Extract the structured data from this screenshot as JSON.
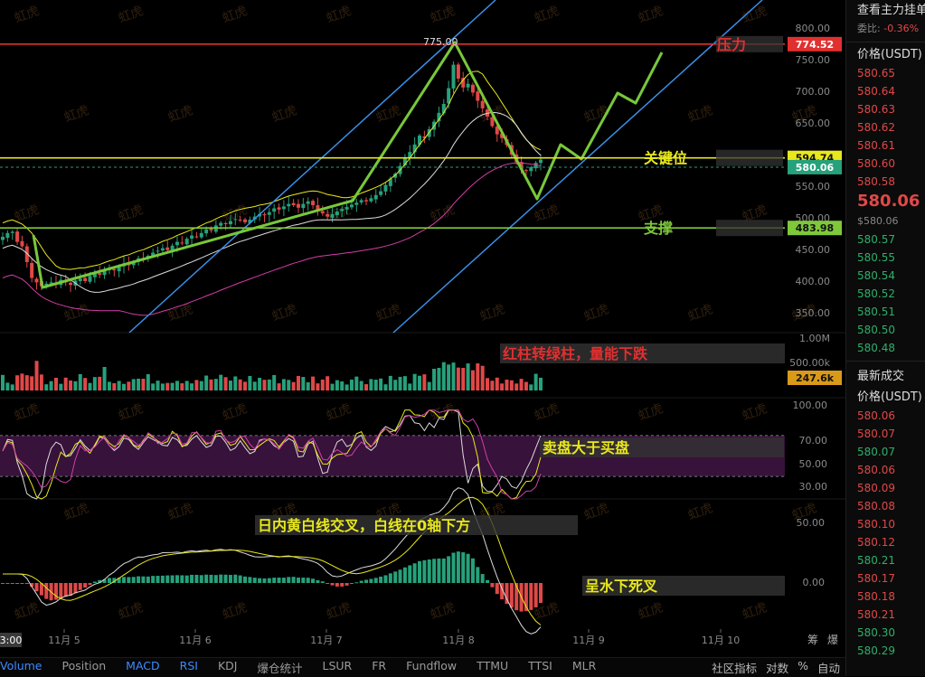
{
  "chart_data": [
    {
      "type": "candlestick",
      "panel": "price",
      "x_labels": [
        "11月 5",
        "11月 6",
        "11月 7",
        "11月 8",
        "11月 9",
        "11月 10"
      ],
      "x_extra_labels": [
        "3:00",
        "筹",
        "爆"
      ],
      "y_ticks": [
        "800.00",
        "750.00",
        "700.00",
        "650.00",
        "600.00",
        "550.00",
        "500.00",
        "450.00",
        "400.00",
        "350.00"
      ],
      "ylim": [
        320,
        820
      ],
      "approx_closes": [
        470,
        476,
        478,
        462,
        455,
        430,
        405,
        398,
        392,
        396,
        398,
        395,
        402,
        398,
        394,
        401,
        404,
        400,
        408,
        412,
        410,
        416,
        420,
        417,
        422,
        428,
        425,
        431,
        436,
        434,
        440,
        445,
        448,
        452,
        449,
        456,
        462,
        460,
        467,
        472,
        470,
        476,
        482,
        480,
        488,
        492,
        490,
        495,
        498,
        496,
        493,
        497,
        502,
        506,
        504,
        509,
        515,
        513,
        518,
        522,
        520,
        516,
        522,
        526,
        520,
        512,
        507,
        502,
        506,
        510,
        514,
        517,
        521,
        524,
        528,
        526,
        531,
        536,
        542,
        552,
        562,
        570,
        582,
        594,
        604,
        616,
        630,
        626,
        640,
        652,
        666,
        680,
        705,
        742,
        720,
        706,
        712,
        698,
        685,
        673,
        660,
        645,
        632,
        626,
        615,
        600,
        588,
        577,
        574,
        580,
        587,
        592
      ],
      "lines": [
        {
          "label": "774.52",
          "value": 774.52,
          "color": "#e03030"
        },
        {
          "label": "594.74",
          "value": 594.74,
          "color": "#e8e81c"
        },
        {
          "label": "580.06",
          "value": 580.06,
          "color": "#26a17b",
          "dashed": true
        },
        {
          "label": "483.98",
          "value": 483.98,
          "color": "#7ec83a"
        }
      ],
      "peak_label": "775.00",
      "annotations": [
        {
          "text": "压力",
          "color": "#e03030"
        },
        {
          "text": "关键位",
          "color": "#e8e81c"
        },
        {
          "text": "支撑",
          "color": "#7ec83a"
        }
      ]
    },
    {
      "type": "bar",
      "panel": "volume",
      "y_ticks": [
        "1.00M",
        "500.00k"
      ],
      "current_label": "247.6k",
      "annotation": "红柱转绿柱，量能下跌"
    },
    {
      "type": "line",
      "panel": "RSI",
      "y_ticks": [
        "100.00",
        "70.00",
        "50.00",
        "30.00"
      ],
      "ylim": [
        0,
        100
      ],
      "band": [
        30,
        70
      ],
      "annotation": "卖盘大于买盘"
    },
    {
      "type": "bar",
      "panel": "MACD",
      "y_ticks": [
        "50.00",
        "0.00"
      ],
      "annotations": [
        "日内黄白线交叉，白线在0轴下方",
        "呈水下死叉"
      ]
    }
  ],
  "watermark": "虹虎",
  "tabs": [
    "Volume",
    "Position",
    "MACD",
    "RSI",
    "KDJ",
    "爆仓统计",
    "LSUR",
    "FR",
    "Fundflow",
    "TTMU",
    "TTSI",
    "MLR"
  ],
  "tabs_right": [
    "社区指标",
    "对数",
    "%",
    "自动"
  ],
  "sidebar": {
    "title": "查看主力挂单",
    "ratio_label": "委比:",
    "ratio_value": "-0.36%",
    "asks_header": "价格(USDT)",
    "asks": [
      "580.65",
      "580.64",
      "580.63",
      "580.62",
      "580.61",
      "580.60",
      "580.58"
    ],
    "last_price": "580.06",
    "last_price_sub": "$580.06",
    "bids": [
      "580.57",
      "580.55",
      "580.54",
      "580.52",
      "580.51",
      "580.50",
      "580.48"
    ],
    "trades_title": "最新成交",
    "trades_header": "价格(USDT)",
    "trades": [
      {
        "p": "580.06",
        "c": "red"
      },
      {
        "p": "580.07",
        "c": "red"
      },
      {
        "p": "580.07",
        "c": "green"
      },
      {
        "p": "580.06",
        "c": "red"
      },
      {
        "p": "580.09",
        "c": "red"
      },
      {
        "p": "580.08",
        "c": "red"
      },
      {
        "p": "580.10",
        "c": "red"
      },
      {
        "p": "580.12",
        "c": "red"
      },
      {
        "p": "580.21",
        "c": "green"
      },
      {
        "p": "580.17",
        "c": "red"
      },
      {
        "p": "580.18",
        "c": "red"
      },
      {
        "p": "580.21",
        "c": "red"
      },
      {
        "p": "580.30",
        "c": "green"
      },
      {
        "p": "580.29",
        "c": "green"
      }
    ]
  }
}
